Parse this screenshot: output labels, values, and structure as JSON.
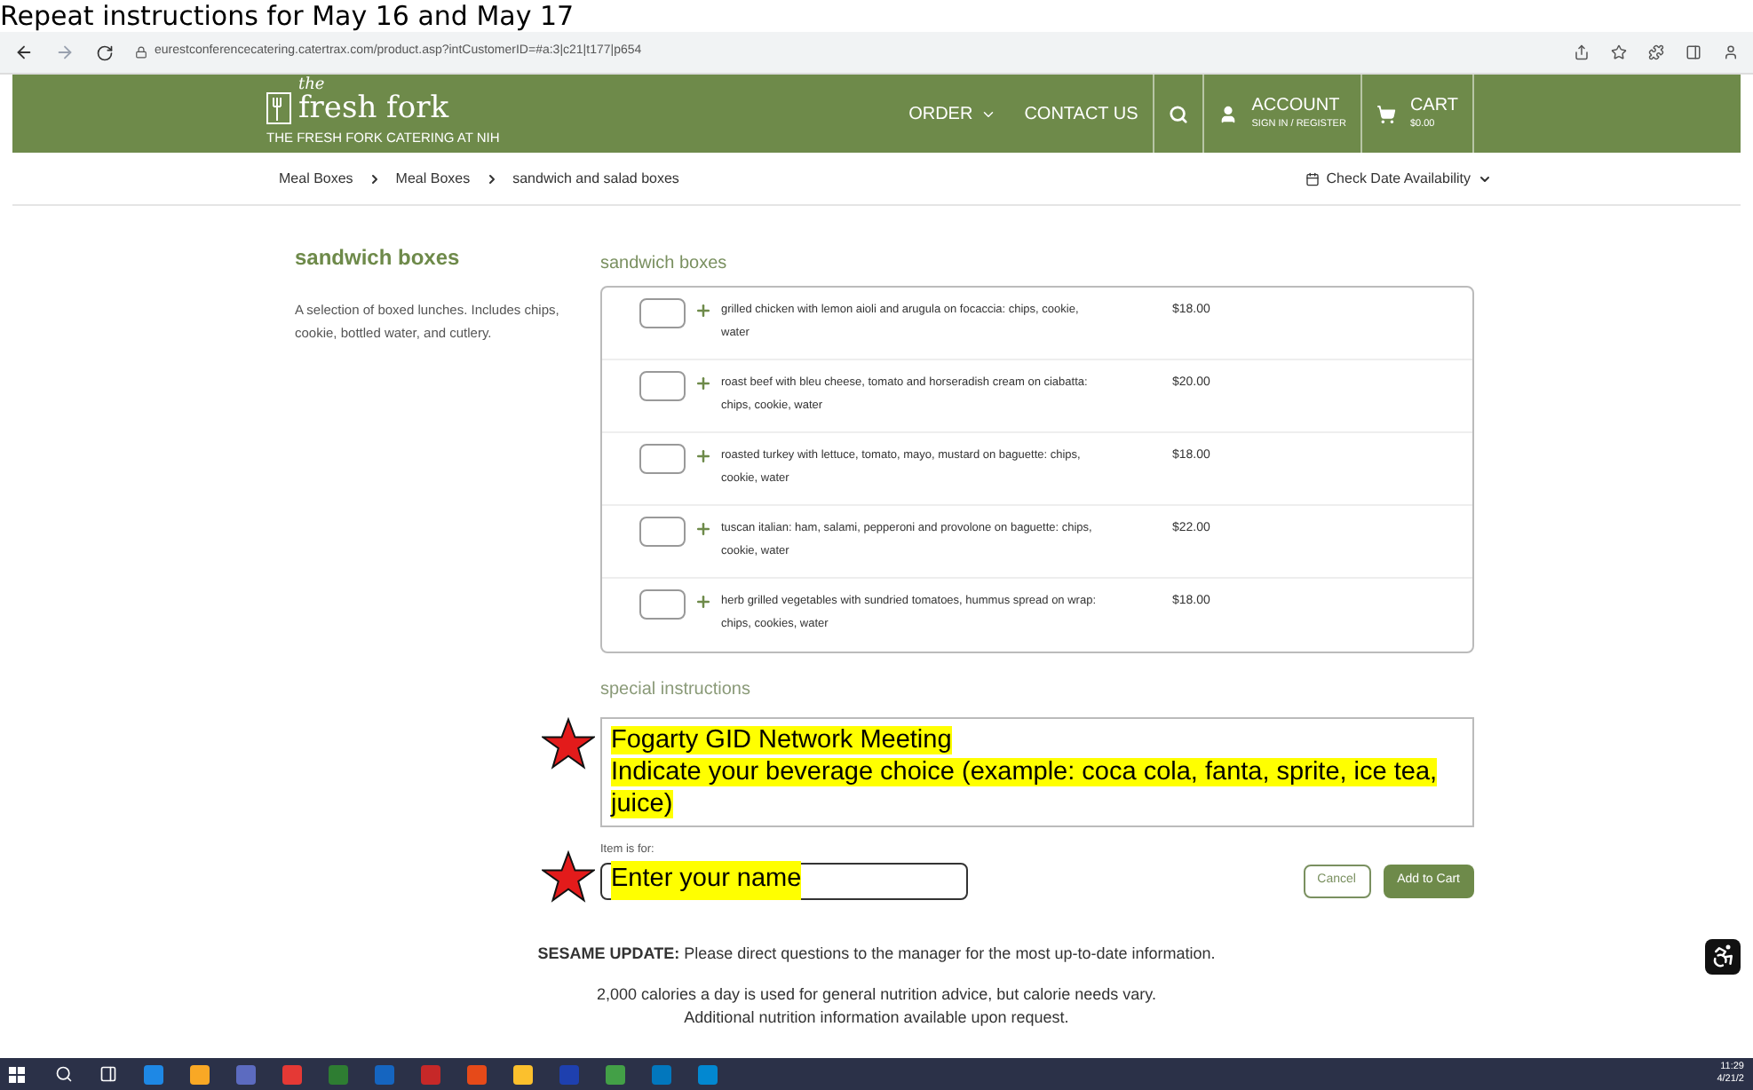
{
  "document_caption": "Repeat instructions for May 16 and May 17",
  "browser": {
    "url": "eurestconferencecatering.catertrax.com/product.asp?intCustomerID=#a:3|c21|t177|p654"
  },
  "header": {
    "logo_small": "the",
    "logo": "fresh fork",
    "tagline": "THE FRESH FORK CATERING AT NIH",
    "order": "ORDER",
    "contact": "CONTACT US",
    "account": {
      "label": "ACCOUNT",
      "sub": "SIGN IN / REGISTER"
    },
    "cart": {
      "label": "CART",
      "sub": "$0.00"
    }
  },
  "breadcrumb": [
    "Meal Boxes",
    "Meal Boxes",
    "sandwich and salad boxes"
  ],
  "date_availability": "Check Date Availability",
  "sidebar": {
    "title": "sandwich boxes",
    "description": "A selection of boxed lunches. Includes chips, cookie, bottled water, and cutlery."
  },
  "products": {
    "title": "sandwich boxes",
    "items": [
      {
        "name": "grilled chicken with lemon aioli and arugula on focaccia: chips, cookie, water",
        "price": "$18.00"
      },
      {
        "name": "roast beef with bleu cheese, tomato and horseradish cream on ciabatta: chips, cookie, water",
        "price": "$20.00"
      },
      {
        "name": "roasted turkey with lettuce, tomato, mayo, mustard on baguette: chips, cookie, water",
        "price": "$18.00"
      },
      {
        "name": "tuscan italian: ham, salami, pepperoni and provolone on baguette: chips, cookie, water",
        "price": "$22.00"
      },
      {
        "name": "herb grilled vegetables with sundried tomatoes, hummus spread on wrap: chips, cookies, water",
        "price": "$18.00"
      }
    ]
  },
  "special_instructions": {
    "label": "special instructions",
    "lines": [
      "Fogarty GID Network Meeting",
      "Indicate your beverage choice (example: coca cola, fanta, sprite, ice tea, juice)"
    ]
  },
  "item_for": {
    "label": "Item is for:",
    "value": "Enter your name"
  },
  "buttons": {
    "cancel": "Cancel",
    "add": "Add to Cart"
  },
  "notice": "**SESAME UPDATE:** Please direct questions to the manager for the most up-to-date information.",
  "nutrition": [
    "2,000 calories a day is used for general nutrition advice, but calorie needs vary.",
    "Additional nutrition information available upon request."
  ],
  "taskbar": {
    "time": "11:29",
    "date": "4/21/2"
  }
}
